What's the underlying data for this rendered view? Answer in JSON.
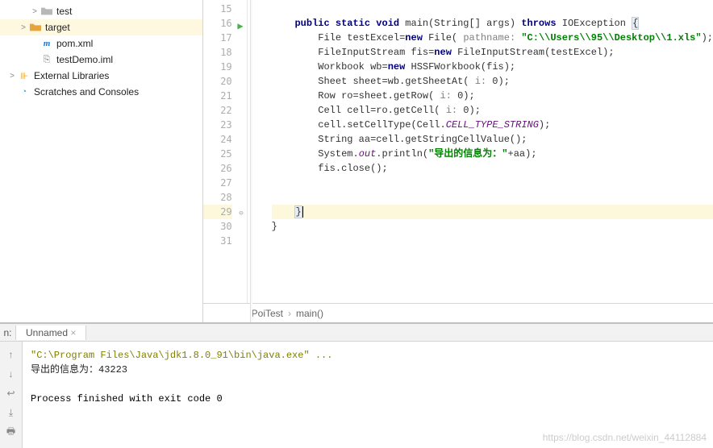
{
  "sidebar": {
    "items": [
      {
        "label": "test",
        "indent": 28,
        "expand": ">",
        "icon": "folder-gray"
      },
      {
        "label": "target",
        "indent": 14,
        "expand": ">",
        "icon": "folder-orange",
        "selected": true
      },
      {
        "label": "pom.xml",
        "indent": 28,
        "expand": "",
        "icon": "maven"
      },
      {
        "label": "testDemo.iml",
        "indent": 28,
        "expand": "",
        "icon": "iml"
      },
      {
        "label": "External Libraries",
        "indent": 0,
        "expand": ">",
        "icon": "lib"
      },
      {
        "label": "Scratches and Consoles",
        "indent": 0,
        "expand": "",
        "icon": "scratch"
      }
    ]
  },
  "gutter": {
    "start": 15,
    "end": 31,
    "run_line": 16,
    "fold_lines": [
      16,
      29
    ],
    "highlight": 29
  },
  "code": {
    "lines": [
      "",
      {
        "t": "    <kw>public static void</kw> main(String[] args) <kw>throws</kw> IOException <span class='brace-match'>{</span>",
        "run": true
      },
      "        File testExcel=<kw>new</kw> File( <param>pathname:</param> <str>\"C:\\\\Users\\\\95\\\\Desktop\\\\1.xls\"</str>);",
      "        FileInputStream fis=<kw>new</kw> FileInputStream(testExcel);",
      "        Workbook wb=<kw>new</kw> HSSFWorkbook(fis);",
      "        Sheet sheet=wb.getSheetAt( <param>i:</param> 0);",
      "        Row ro=sheet.getRow( <param>i:</param> 0);",
      "        Cell cell=ro.getCell( <param>i:</param> 0);",
      "        cell.setCellType(Cell.<field>CELL_TYPE_STRING</field>);",
      "        String aa=cell.getStringCellValue();",
      "        System.<field>out</field>.println(<str>\"导出的信息为：\"</str>+aa);",
      "        fis.close();",
      "",
      "",
      {
        "t": "    <span class='brace-match'>}</span><span class='caret'></span>",
        "hl": true
      },
      "}",
      ""
    ]
  },
  "breadcrumb": {
    "class": "PoiTest",
    "method": "main()"
  },
  "bottom": {
    "left_tab": "n:",
    "tab": "Unnamed",
    "console": {
      "cmd": "\"C:\\Program Files\\Java\\jdk1.8.0_91\\bin\\java.exe\" ...",
      "out": "导出的信息为：43223",
      "exit": "Process finished with exit code 0"
    }
  },
  "watermark": "https://blog.csdn.net/weixin_44112884"
}
